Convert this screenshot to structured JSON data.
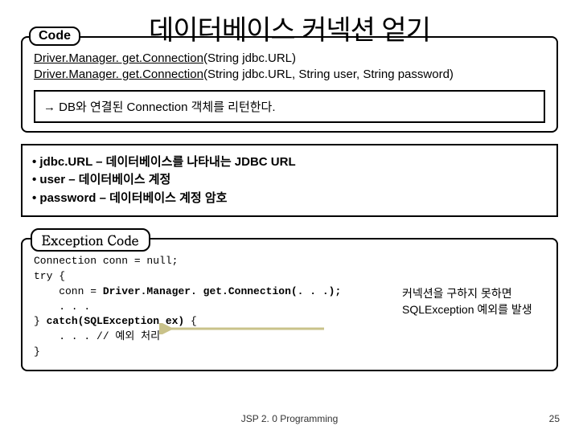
{
  "title": "데이터베이스 커넥션 얻기",
  "box1": {
    "label": "Code",
    "sig1_a": "Driver.Manager. get.Connection",
    "sig1_b": "(String jdbc.URL)",
    "sig2_a": "Driver.Manager. get.Connection",
    "sig2_b": "(String jdbc.URL, String user, String password)",
    "inner": "→ DB와 연결된 Connection 객체를 리턴한다."
  },
  "bullets": {
    "l1": "• jdbc.URL – 데이터베이스를 나타내는 JDBC URL",
    "l2": "• user – 데이터베이스 계정",
    "l3": "• password – 데이터베이스 계정 암호"
  },
  "box2": {
    "label": "Exception Code",
    "c1": "Connection conn = null;",
    "c2": "try {",
    "c3a": "    conn = ",
    "c3b": "Driver.Manager. get.Connection(. . .);",
    "c4": "    . . .",
    "c5a": "} ",
    "c5b": "catch(SQLException ex)",
    "c5c": " {",
    "c6": "    . . . // 예외 처리",
    "c7": "}",
    "note1": "커넥션을 구하지 못하면",
    "note2": "SQLException 예외를 발생"
  },
  "footer": {
    "center": "JSP 2. 0 Programming",
    "right": "25"
  }
}
